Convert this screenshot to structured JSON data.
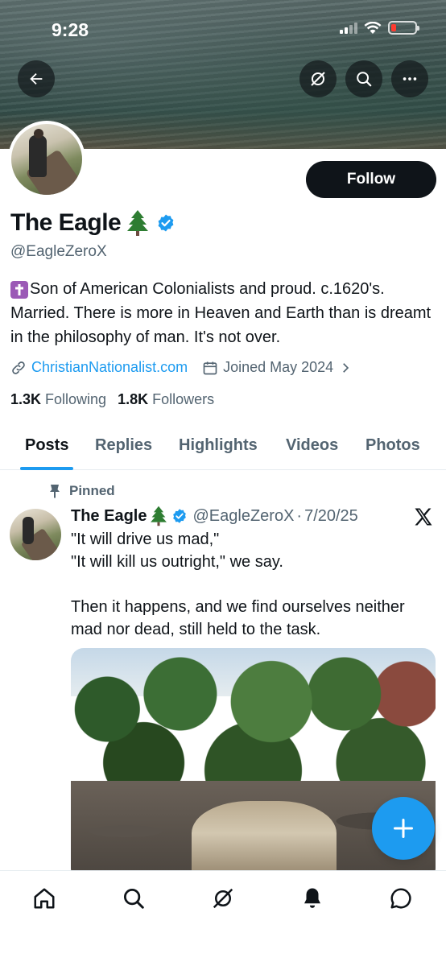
{
  "status_bar": {
    "time": "9:28"
  },
  "profile": {
    "display_name": "The Eagle",
    "handle": "@EagleZeroX",
    "bio_text": "Son of American Colonialists and proud. c.1620's. Married. There is more in Heaven and Earth than is dreamt in the philosophy of man. It's not over.",
    "website": "ChristianNationalist.com",
    "joined": "Joined May 2024",
    "following_count": "1.3K",
    "following_label": "Following",
    "followers_count": "1.8K",
    "followers_label": "Followers",
    "follow_button": "Follow"
  },
  "tabs": [
    {
      "label": "Posts",
      "active": true
    },
    {
      "label": "Replies"
    },
    {
      "label": "Highlights"
    },
    {
      "label": "Videos"
    },
    {
      "label": "Photos"
    }
  ],
  "pinned_tweet": {
    "pinned_label": "Pinned",
    "author": "The Eagle",
    "handle": "@EagleZeroX",
    "date": "7/20/25",
    "text": "\"It will drive us mad,\"\n\"It will kill us outright,\" we say.\n\nThen it happens, and we find ourselves neither mad nor dead, still held to the task."
  },
  "icons": {
    "back": "back-arrow-icon",
    "grok": "grok-icon",
    "search": "search-icon",
    "more": "more-icon",
    "compose": "plus-icon",
    "nav": [
      "home-icon",
      "search-icon",
      "grok-icon",
      "notifications-icon",
      "messages-icon"
    ]
  },
  "colors": {
    "accent": "#1d9bf0",
    "verified": "#1d9bf0",
    "text": "#0f1419",
    "muted": "#536471"
  }
}
